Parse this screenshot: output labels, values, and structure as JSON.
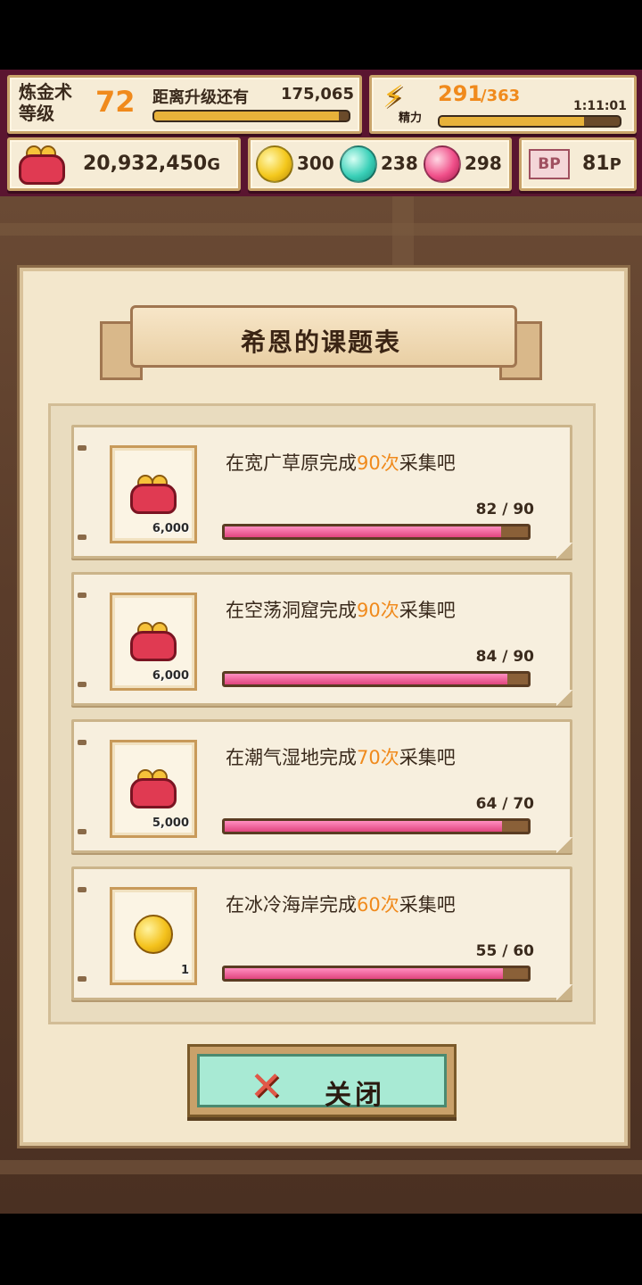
{
  "status_bar": {
    "level_label_line1": "炼金术",
    "level_label_line2": "等级",
    "level_value": "72",
    "next_level_label": "距离升级还有",
    "next_level_value": "175,065",
    "next_level_progress": 0.95,
    "energy_label": "精力",
    "energy_current": "291",
    "energy_max": "/363",
    "energy_timer": "1:11:01",
    "energy_progress": 0.8,
    "gold_value": "20,932,450",
    "gold_unit": "G",
    "yellow_orb_count": "300",
    "cyan_orb_count": "238",
    "pink_orb_count": "298",
    "bp_icon_text": "BP",
    "bp_value": "81",
    "bp_unit": "P"
  },
  "dialog": {
    "title": "希恩的课题表",
    "tasks": [
      {
        "reward_icon": "purse-icon",
        "reward_qty": "6,000",
        "prefix": "在宽广草原完成",
        "count": "90次",
        "suffix": "采集吧",
        "progress_text": "82 / 90",
        "current": 82,
        "target": 90
      },
      {
        "reward_icon": "purse-icon",
        "reward_qty": "6,000",
        "prefix": "在空荡洞窟完成",
        "count": "90次",
        "suffix": "采集吧",
        "progress_text": "84 / 90",
        "current": 84,
        "target": 90
      },
      {
        "reward_icon": "purse-icon",
        "reward_qty": "5,000",
        "prefix": "在潮气湿地完成",
        "count": "70次",
        "suffix": "采集吧",
        "progress_text": "64 / 70",
        "current": 64,
        "target": 70
      },
      {
        "reward_icon": "coin-icon",
        "reward_qty": "1",
        "prefix": "在冰冷海岸完成",
        "count": "60次",
        "suffix": "采集吧",
        "progress_text": "55 / 60",
        "current": 55,
        "target": 60
      }
    ],
    "close_label": "关闭"
  },
  "colors": {
    "accent_orange": "#f08a1c",
    "progress_pink": "#e0457e",
    "bar_frame": "#5a1530",
    "close_button_bg": "#a8ead4"
  }
}
